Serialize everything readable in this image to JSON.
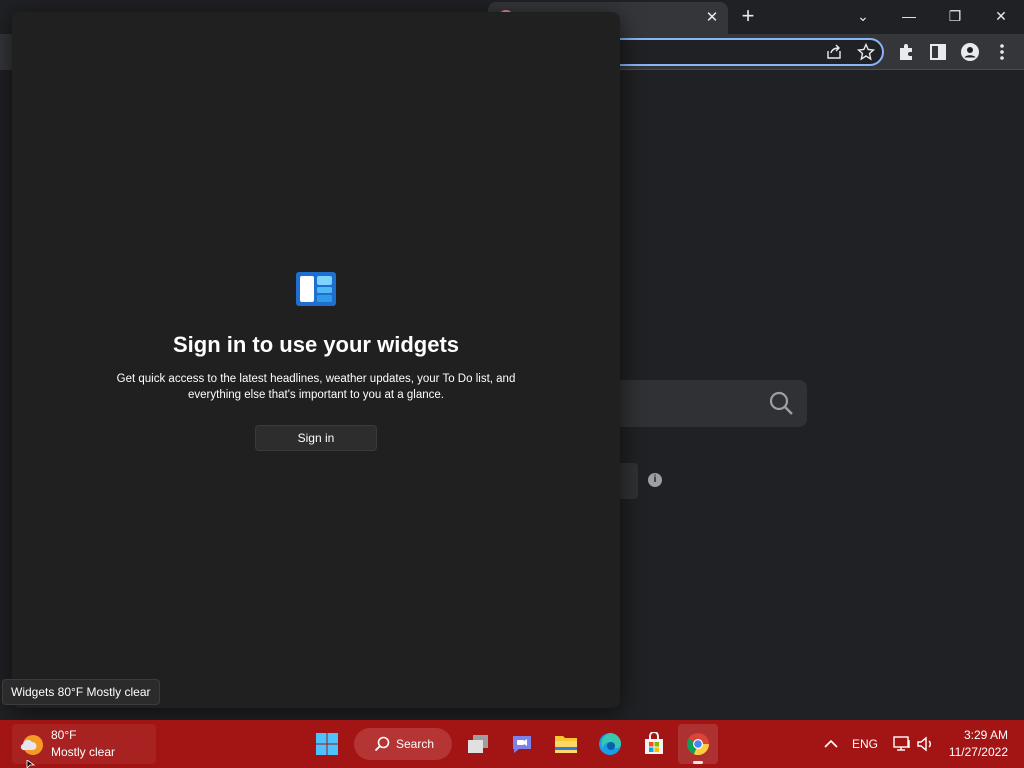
{
  "browser": {
    "tab_close": "✕",
    "new_tab": "+",
    "window_controls": {
      "dropdown": "⌄",
      "minimize": "—",
      "restore": "❐",
      "close": "✕"
    }
  },
  "widgets": {
    "title": "Sign in to use your widgets",
    "description": "Get quick access to the latest headlines, weather updates, your To Do list, and everything else that's important to you at a glance.",
    "signin_label": "Sign in"
  },
  "tooltip": {
    "text": "Widgets 80°F Mostly clear"
  },
  "taskbar": {
    "weather": {
      "temp": "80°F",
      "condition": "Mostly clear"
    },
    "search_label": "Search",
    "apps": [
      "start",
      "search",
      "task-view",
      "teams-chat",
      "file-explorer",
      "edge",
      "store",
      "chrome"
    ],
    "tray": {
      "language": "ENG",
      "time": "3:29 AM",
      "date": "11/27/2022"
    }
  },
  "colors": {
    "taskbar": "#a31515",
    "panel": "#202020",
    "accent": "#8ab4f8"
  }
}
